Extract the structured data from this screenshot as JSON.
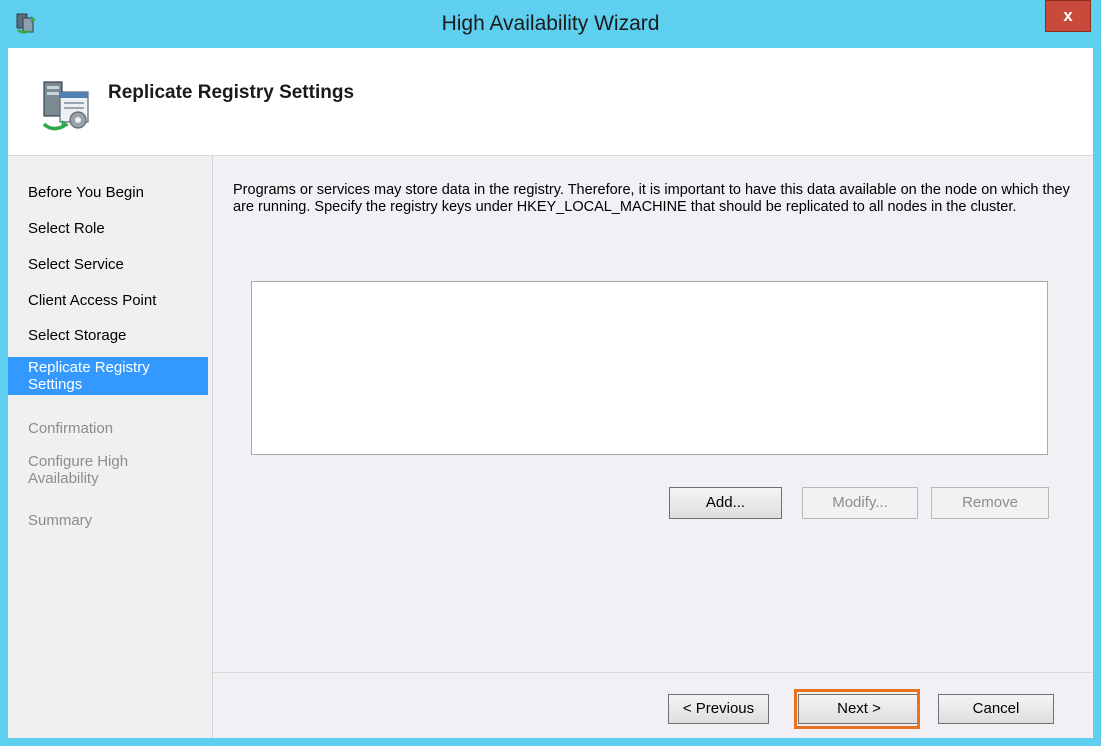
{
  "window": {
    "title": "High Availability Wizard",
    "close_label": "x",
    "frame_color": "#5ecfef",
    "app_icon": "cluster-wizard-icon"
  },
  "header": {
    "title": "Replicate Registry Settings",
    "icon": "server-registry-icon"
  },
  "sidebar": {
    "steps": [
      {
        "label": "Before You Begin",
        "state": "done"
      },
      {
        "label": "Select Role",
        "state": "done"
      },
      {
        "label": "Select Service",
        "state": "done"
      },
      {
        "label": "Client Access Point",
        "state": "done"
      },
      {
        "label": "Select Storage",
        "state": "done"
      },
      {
        "label": "Replicate Registry Settings",
        "state": "current"
      },
      {
        "label": "Confirmation",
        "state": "pending"
      },
      {
        "label": "Configure High Availability",
        "state": "pending"
      },
      {
        "label": "Summary",
        "state": "pending"
      }
    ],
    "active_color": "#3399ff"
  },
  "main": {
    "description": "Programs or services may store data in the registry.  Therefore, it is important to have this data available on the node on which they are running.  Specify the registry keys under HKEY_LOCAL_MACHINE that should be replicated to all nodes in the cluster.",
    "buttons": {
      "add": "Add...",
      "modify": "Modify...",
      "remove": "Remove"
    }
  },
  "footer": {
    "previous": "< Previous",
    "next": "Next >",
    "cancel": "Cancel",
    "highlight_color": "#e8721f"
  }
}
